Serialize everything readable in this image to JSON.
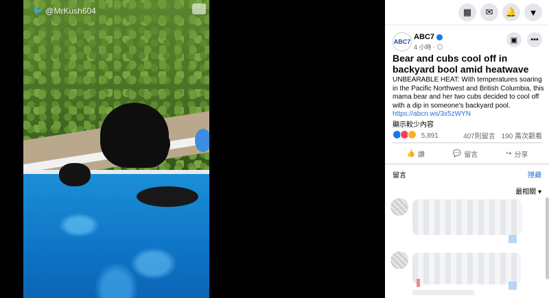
{
  "video": {
    "handle": "@MrKush604"
  },
  "post": {
    "page_name": "ABC7",
    "avatar_text": "ABC7",
    "time": "4 小時 ·",
    "title": "Bear and cubs cool off in backyard bool amid heatwave",
    "body": "UNBEARABLE HEAT: With temperatures soaring in the Pacific Northwest and British Columbia, this mama bear and her two cubs decided to cool off with a dip in someone's backyard pool.",
    "link": "https://abcn.ws/3x5zWYN",
    "show_less": "顯示較少內容",
    "reaction_count": "5,891",
    "comment_count": "407則留言",
    "view_count": "190 萬次觀看",
    "actions": {
      "like": "讚",
      "comment": "留言",
      "share": "分享"
    }
  },
  "comments": {
    "header": "留言",
    "hide": "隱藏",
    "sort": "最相關"
  },
  "colors": {
    "accent": "#1877f2",
    "link": "#216fdb",
    "pool": "#1b8fd6"
  },
  "icons": [
    "twitter-icon",
    "grid-menu-icon",
    "messenger-icon",
    "bell-icon",
    "caret-down-icon",
    "verified-icon",
    "globe-icon",
    "save-icon",
    "more-icon",
    "like-icon",
    "comment-icon",
    "share-icon"
  ]
}
